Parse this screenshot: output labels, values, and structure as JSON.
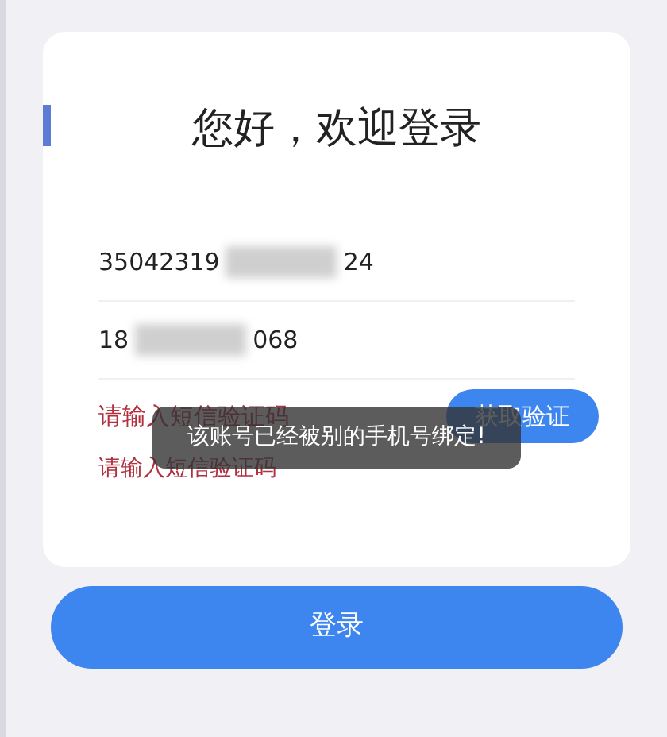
{
  "title": "您好，欢迎登录",
  "fields": [
    {
      "value_start": "35042319",
      "value_end": "24",
      "redacted": true
    },
    {
      "value_start": "18",
      "value_end": "068",
      "redacted": true
    }
  ],
  "code_field": {
    "placeholder": "请输入短信验证码",
    "button": "获取验证"
  },
  "error": "请输入短信验证码",
  "toast": "该账号已经被别的手机号绑定!",
  "login_button": "登录"
}
